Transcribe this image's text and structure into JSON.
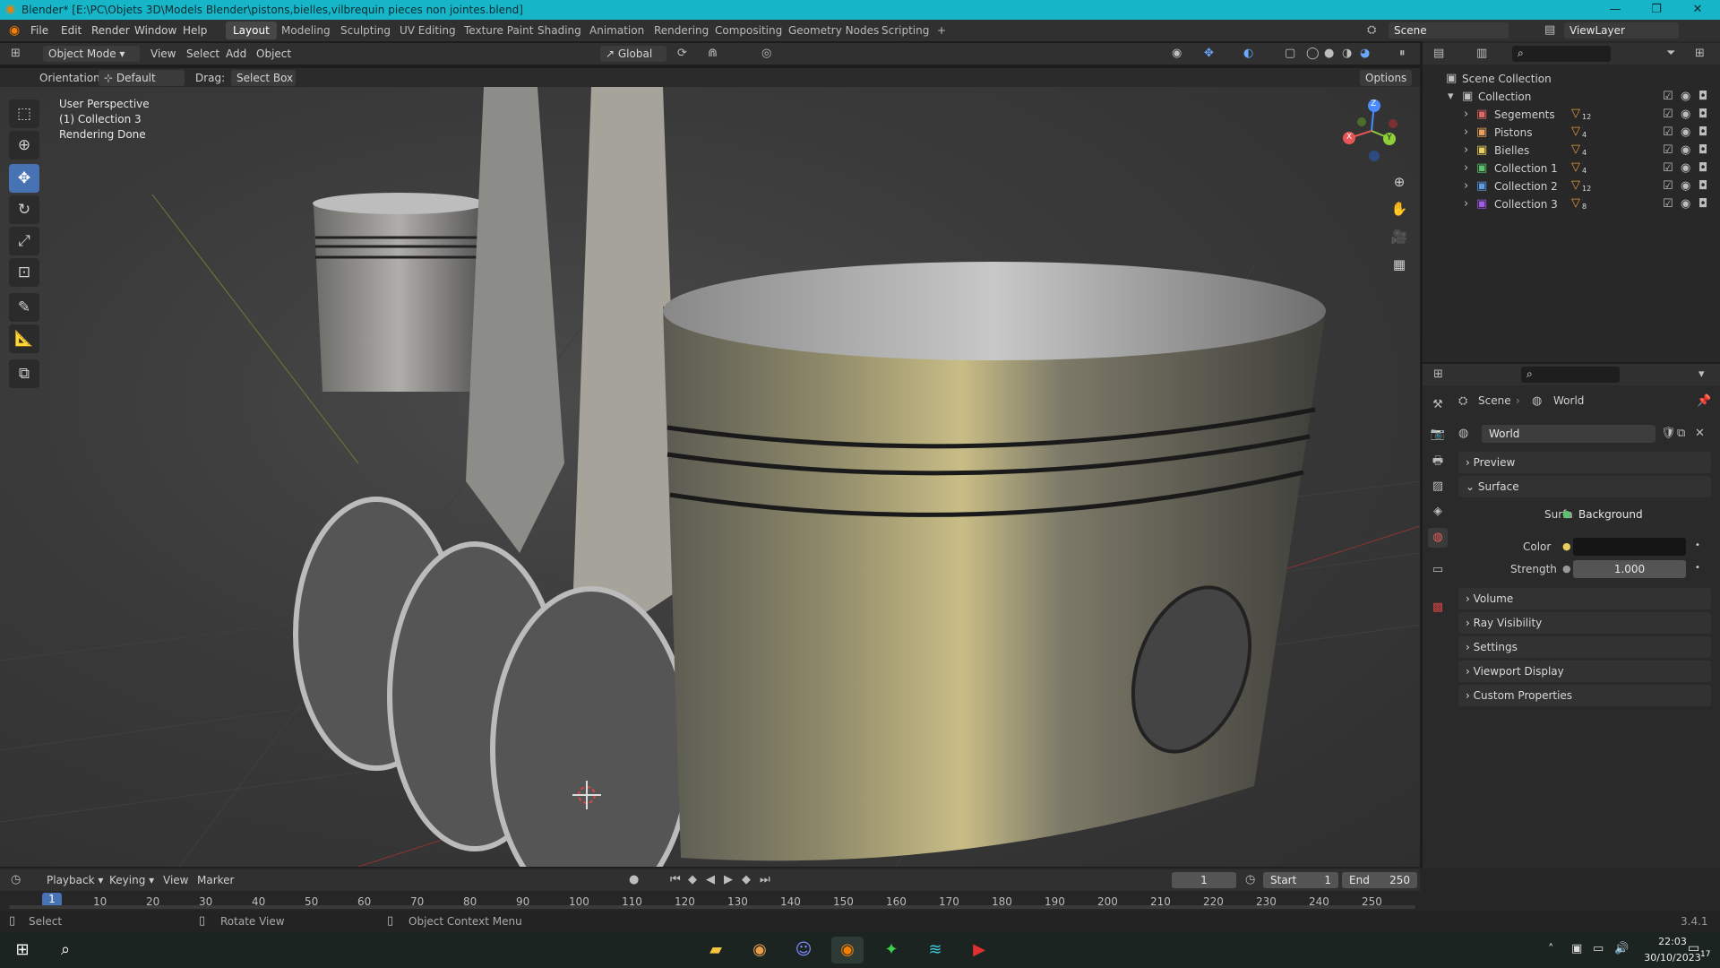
{
  "window": {
    "title": "Blender* [E:\\PC\\Objets 3D\\Models Blender\\pistons,bielles,vilbrequin pieces non jointes.blend]",
    "minimize": "—",
    "maximize": "❐",
    "close": "✕"
  },
  "menus": [
    "File",
    "Edit",
    "Render",
    "Window",
    "Help"
  ],
  "workspaces": [
    "Layout",
    "Modeling",
    "Sculpting",
    "UV Editing",
    "Texture Paint",
    "Shading",
    "Animation",
    "Rendering",
    "Compositing",
    "Geometry Nodes",
    "Scripting"
  ],
  "add_workspace": "+",
  "scene_selector": {
    "scene": "Scene",
    "view_layer": "ViewLayer"
  },
  "viewport_header": {
    "mode": "Object Mode",
    "menus": [
      "View",
      "Select",
      "Add",
      "Object"
    ],
    "transform_orientation": "Global",
    "options": "Options"
  },
  "tool_settings": {
    "orientation_label": "Orientation:",
    "orientation_value": "Default",
    "drag_label": "Drag:",
    "drag_value": "Select Box"
  },
  "viewport_overlay": {
    "line1": "User Perspective",
    "line2": "(1) Collection 3",
    "line3": "Rendering Done"
  },
  "gizmo": {
    "x": "X",
    "y": "Y",
    "z": "Z"
  },
  "outliner": {
    "root": "Scene Collection",
    "collection": "Collection",
    "children": [
      {
        "name": "Segements",
        "count": "12",
        "color": "#e06666"
      },
      {
        "name": "Pistons",
        "count": "4",
        "color": "#e8a05b"
      },
      {
        "name": "Bielles",
        "count": "4",
        "color": "#e8cf5b"
      },
      {
        "name": "Collection 1",
        "count": "4",
        "color": "#5bc46b"
      },
      {
        "name": "Collection 2",
        "count": "12",
        "color": "#5b9be8"
      },
      {
        "name": "Collection 3",
        "count": "8",
        "color": "#a15be8"
      }
    ]
  },
  "properties": {
    "breadcrumb": [
      "Scene",
      "World"
    ],
    "datablock": "World",
    "panels": {
      "preview": "Preview",
      "surface": "Surface",
      "volume": "Volume",
      "ray_visibility": "Ray Visibility",
      "settings": "Settings",
      "viewport_display": "Viewport Display",
      "custom_properties": "Custom Properties"
    },
    "surface_label": "Surface",
    "surface_value": "Background",
    "color_label": "Color",
    "strength_label": "Strength",
    "strength_value": "1.000"
  },
  "timeline": {
    "menus": [
      "Playback",
      "Keying",
      "View",
      "Marker"
    ],
    "current_frame": "1",
    "start_label": "Start",
    "start": "1",
    "end_label": "End",
    "end": "250",
    "ticks": [
      "10",
      "20",
      "30",
      "40",
      "50",
      "60",
      "70",
      "80",
      "90",
      "100",
      "110",
      "120",
      "130",
      "140",
      "150",
      "160",
      "170",
      "180",
      "190",
      "200",
      "210",
      "220",
      "230",
      "240",
      "250"
    ],
    "playhead": "1"
  },
  "status": {
    "select": "Select",
    "rotate": "Rotate View",
    "context": "Object Context Menu",
    "version": "3.4.1"
  },
  "taskbar": {
    "time": "22:03",
    "date": "30/10/2023",
    "notifications": "17"
  }
}
